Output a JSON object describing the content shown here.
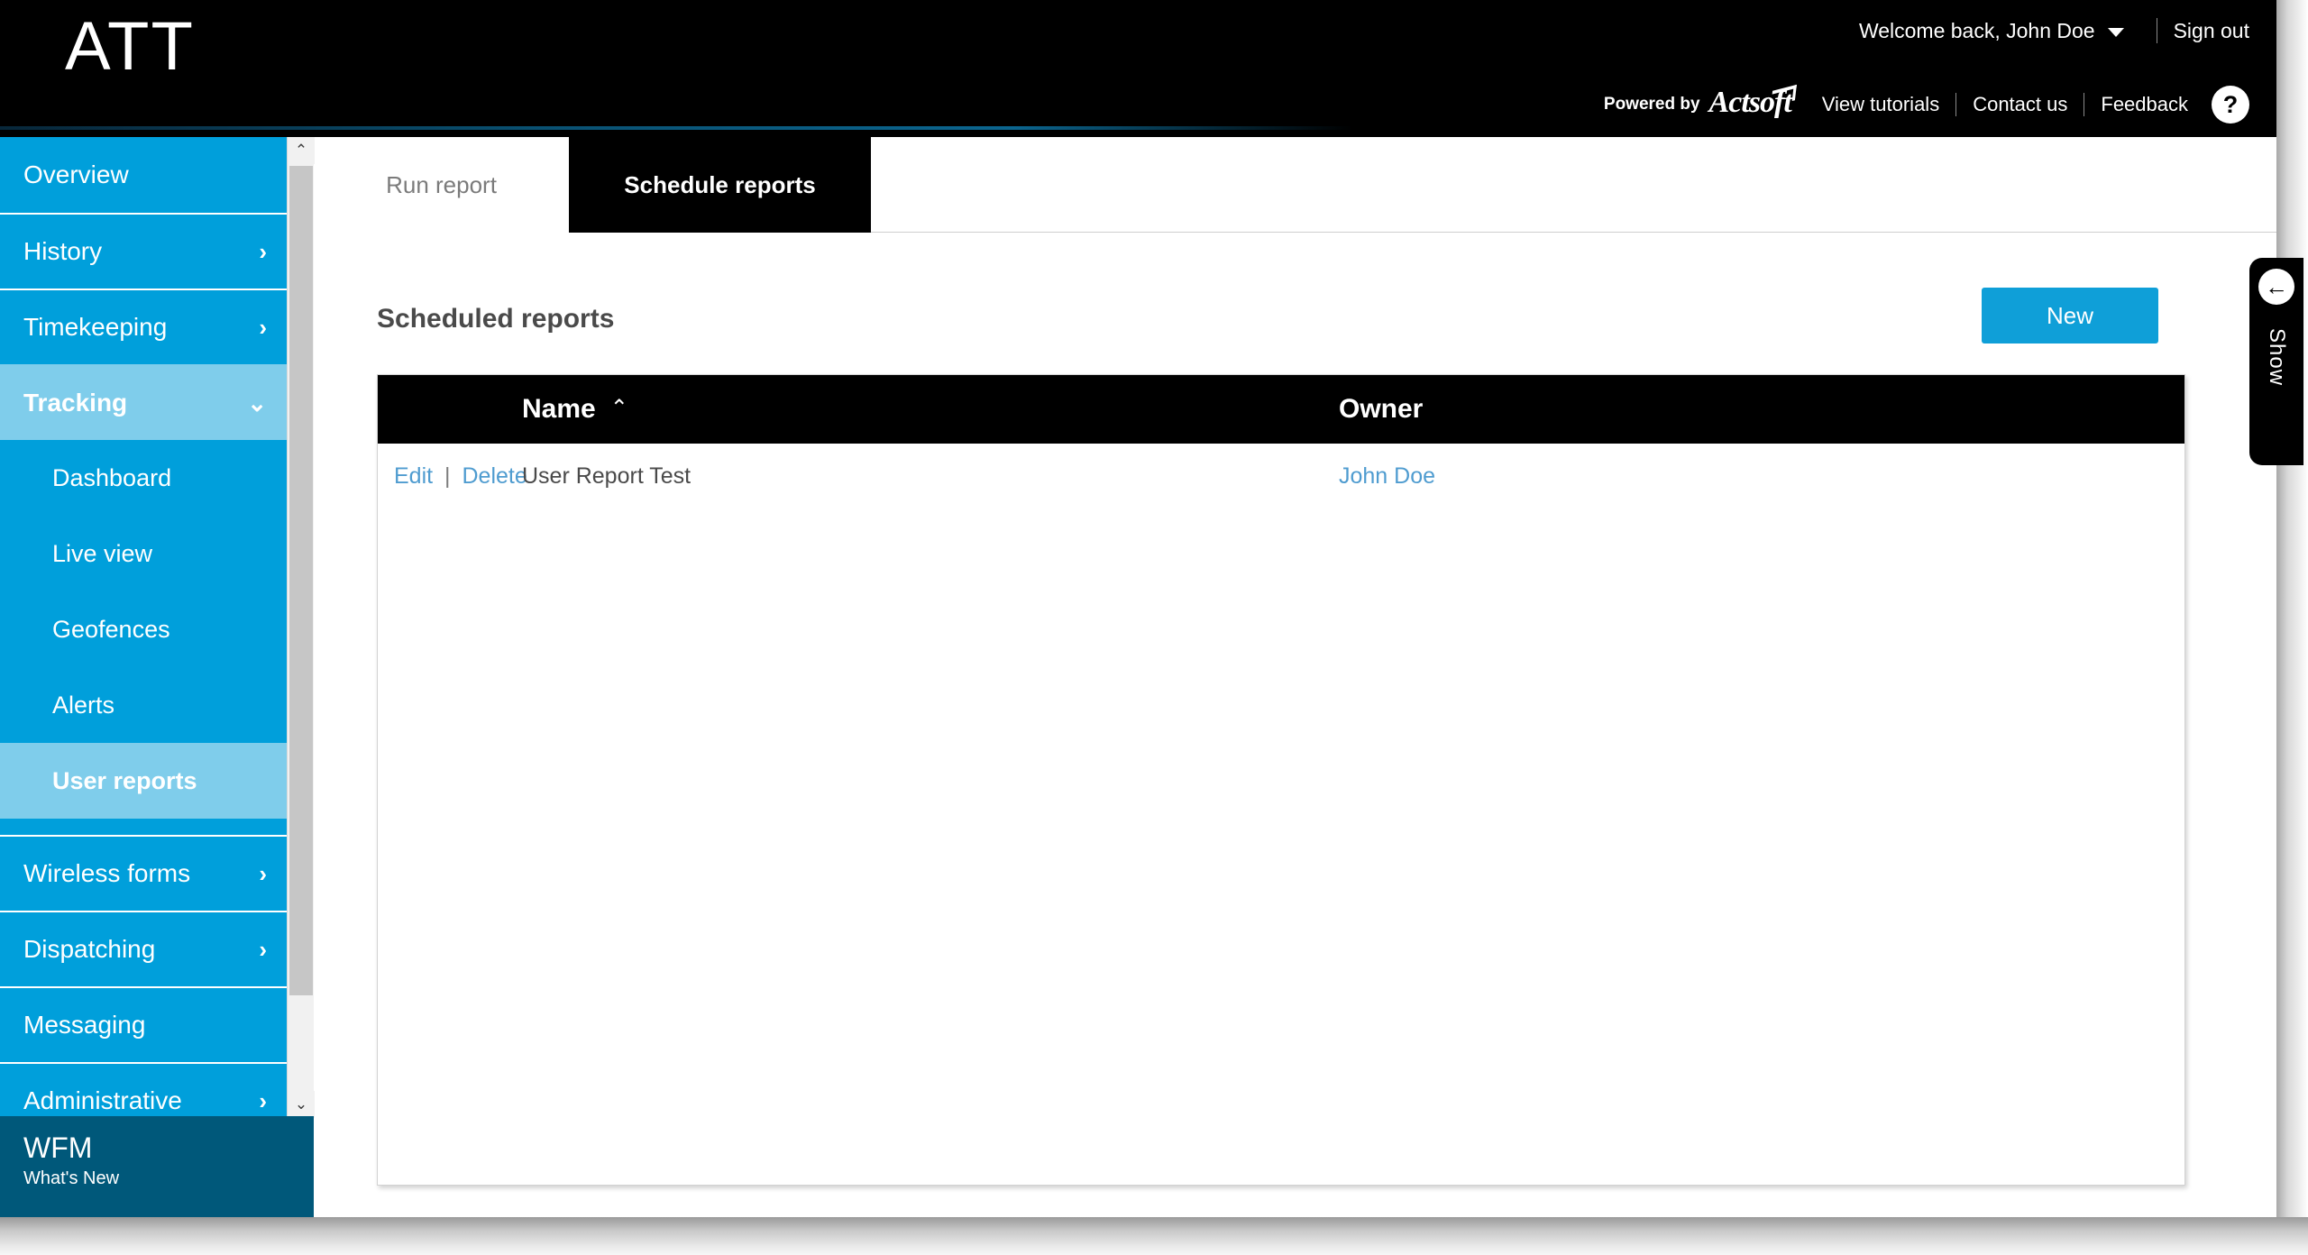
{
  "header": {
    "brand": "ATT",
    "welcome": "Welcome back, John Doe",
    "caret_icon": "chevron-down-icon",
    "sign_out": "Sign out",
    "powered_by": "Powered by",
    "actsoft": "Actsoft",
    "links": [
      "View tutorials",
      "Contact us",
      "Feedback"
    ],
    "help": "?"
  },
  "sidebar": {
    "items": [
      {
        "label": "Overview",
        "chevron": "",
        "active": false
      },
      {
        "label": "History",
        "chevron": "›",
        "active": false
      },
      {
        "label": "Timekeeping",
        "chevron": "›",
        "active": false
      },
      {
        "label": "Tracking",
        "chevron": "⌄",
        "active": true
      }
    ],
    "sub_items": [
      {
        "label": "Dashboard",
        "active": false
      },
      {
        "label": "Live view",
        "active": false
      },
      {
        "label": "Geofences",
        "active": false
      },
      {
        "label": "Alerts",
        "active": false
      },
      {
        "label": "User reports",
        "active": true
      }
    ],
    "items_after": [
      {
        "label": "Wireless forms",
        "chevron": "›",
        "active": false
      },
      {
        "label": "Dispatching",
        "chevron": "›",
        "active": false
      },
      {
        "label": "Messaging",
        "chevron": "",
        "active": false
      },
      {
        "label": "Administrative",
        "chevron": "›",
        "active": false
      }
    ],
    "scrollbar": {
      "up_icon": "⌃",
      "down_icon": "⌄"
    },
    "footer": {
      "title": "WFM",
      "subtitle": "What's New"
    }
  },
  "tabs": [
    {
      "label": "Run report",
      "active": false
    },
    {
      "label": "Schedule reports",
      "active": true
    }
  ],
  "main": {
    "title": "Scheduled reports",
    "new_button": "New",
    "table": {
      "columns": [
        "",
        "Name",
        "Owner"
      ],
      "sort_column": "Name",
      "sort_icon": "⌃",
      "rows": [
        {
          "edit": "Edit",
          "separator": "|",
          "delete": "Delete",
          "name": "User Report Test",
          "owner": "John Doe"
        }
      ]
    }
  },
  "show_panel": {
    "label": "Show",
    "arrow_icon": "←"
  },
  "colors": {
    "brand_blue": "#009fdb",
    "accent_blue": "#0f9fd8",
    "active_nav": "#7fcdeb",
    "link_blue": "#4f9cd0",
    "header_black": "#000000",
    "wfm_teal": "#00587a"
  }
}
